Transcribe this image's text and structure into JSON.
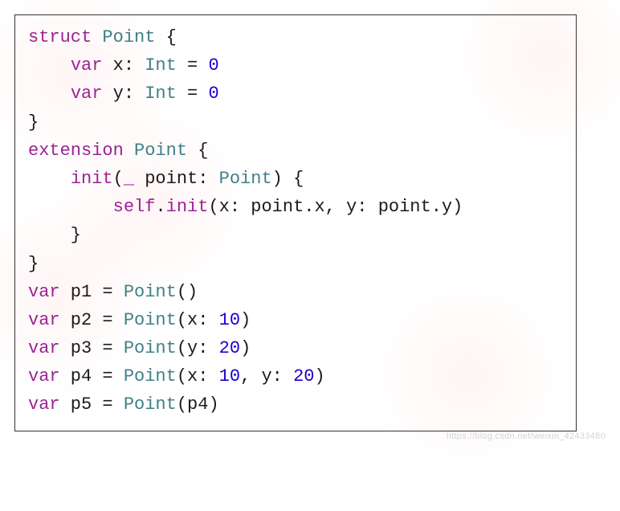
{
  "code": {
    "tokens": [
      {
        "t": "struct",
        "c": "kw"
      },
      {
        "t": " "
      },
      {
        "t": "Point",
        "c": "ty"
      },
      {
        "t": " {"
      },
      {
        "nl": true
      },
      {
        "t": "    "
      },
      {
        "t": "var",
        "c": "kw"
      },
      {
        "t": " x: "
      },
      {
        "t": "Int",
        "c": "ty"
      },
      {
        "t": " = "
      },
      {
        "t": "0",
        "c": "nm"
      },
      {
        "nl": true
      },
      {
        "t": "    "
      },
      {
        "t": "var",
        "c": "kw"
      },
      {
        "t": " y: "
      },
      {
        "t": "Int",
        "c": "ty"
      },
      {
        "t": " = "
      },
      {
        "t": "0",
        "c": "nm"
      },
      {
        "nl": true
      },
      {
        "t": "}"
      },
      {
        "nl": true
      },
      {
        "t": "extension",
        "c": "kw"
      },
      {
        "t": " "
      },
      {
        "t": "Point",
        "c": "ty"
      },
      {
        "t": " {"
      },
      {
        "nl": true
      },
      {
        "t": "    "
      },
      {
        "t": "init",
        "c": "kw"
      },
      {
        "t": "("
      },
      {
        "t": "_",
        "c": "kw"
      },
      {
        "t": " point: "
      },
      {
        "t": "Point",
        "c": "ty"
      },
      {
        "t": ") {"
      },
      {
        "nl": true
      },
      {
        "t": "        "
      },
      {
        "t": "self",
        "c": "kw"
      },
      {
        "t": "."
      },
      {
        "t": "init",
        "c": "kw"
      },
      {
        "t": "(x: point.x, y: point.y)"
      },
      {
        "nl": true
      },
      {
        "t": "    }"
      },
      {
        "nl": true
      },
      {
        "t": "}"
      },
      {
        "nl": true
      },
      {
        "t": "var",
        "c": "kw"
      },
      {
        "t": " p1 = "
      },
      {
        "t": "Point",
        "c": "ty"
      },
      {
        "t": "()"
      },
      {
        "nl": true
      },
      {
        "t": "var",
        "c": "kw"
      },
      {
        "t": " p2 = "
      },
      {
        "t": "Point",
        "c": "ty"
      },
      {
        "t": "(x: "
      },
      {
        "t": "10",
        "c": "nm"
      },
      {
        "t": ")"
      },
      {
        "nl": true
      },
      {
        "t": "var",
        "c": "kw"
      },
      {
        "t": " p3 = "
      },
      {
        "t": "Point",
        "c": "ty"
      },
      {
        "t": "(y: "
      },
      {
        "t": "20",
        "c": "nm"
      },
      {
        "t": ")"
      },
      {
        "nl": true
      },
      {
        "t": "var",
        "c": "kw"
      },
      {
        "t": " p4 = "
      },
      {
        "t": "Point",
        "c": "ty"
      },
      {
        "t": "(x: "
      },
      {
        "t": "10",
        "c": "nm"
      },
      {
        "t": ", y: "
      },
      {
        "t": "20",
        "c": "nm"
      },
      {
        "t": ")"
      },
      {
        "nl": true
      },
      {
        "t": "var",
        "c": "kw"
      },
      {
        "t": " p5 = "
      },
      {
        "t": "Point",
        "c": "ty"
      },
      {
        "t": "(p4)"
      }
    ]
  },
  "attribution": "https://blog.csdn.net/weixin_42433480"
}
